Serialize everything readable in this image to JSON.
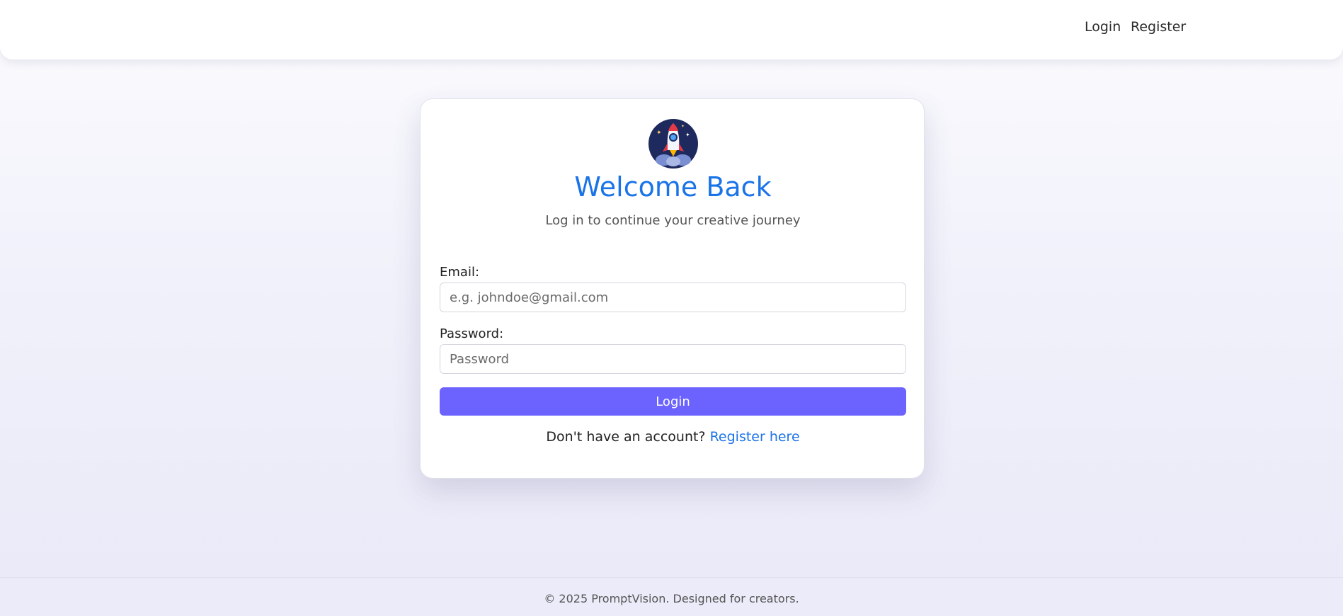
{
  "nav": {
    "login_label": "Login",
    "register_label": "Register"
  },
  "card": {
    "logo_icon": "rocket-icon",
    "title": "Welcome Back",
    "subtitle": "Log in to continue your creative journey",
    "email": {
      "label": "Email:",
      "placeholder": "e.g. johndoe@gmail.com",
      "value": ""
    },
    "password": {
      "label": "Password:",
      "placeholder": "Password",
      "value": ""
    },
    "login_button_label": "Login",
    "register_prompt": "Don't have an account? ",
    "register_link_label": "Register here"
  },
  "footer": {
    "text": "© 2025 PromptVision. Designed for creators."
  },
  "colors": {
    "accent_blue": "#1a73e8",
    "button_purple": "#6c63ff",
    "logo_navy": "#1e2a5e",
    "rocket_red": "#e63946"
  }
}
